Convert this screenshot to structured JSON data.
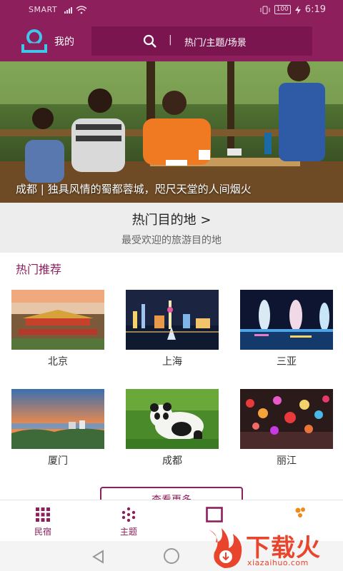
{
  "status_bar": {
    "carrier": "SMART",
    "battery": "100",
    "time": "6:19"
  },
  "header": {
    "my_label": "我的",
    "search_text": "热门/主题/场景",
    "separator": "|"
  },
  "hero": {
    "caption": "成都 | 独具风情的蜀都蓉城，咫尺天堂的人间烟火"
  },
  "destinations": {
    "title": "热门目的地 >",
    "subtitle": "最受欢迎的旅游目的地"
  },
  "recommend": {
    "title": "热门推荐",
    "cities": [
      {
        "name": "北京",
        "theme": "forbidden-city"
      },
      {
        "name": "上海",
        "theme": "bund-night"
      },
      {
        "name": "三亚",
        "theme": "phoenix-island-night"
      },
      {
        "name": "厦门",
        "theme": "xiamen-sunset"
      },
      {
        "name": "成都",
        "theme": "panda"
      },
      {
        "name": "丽江",
        "theme": "lanterns"
      }
    ]
  },
  "more_button": {
    "label": "查看更多"
  },
  "tabs": [
    {
      "label": "民宿",
      "icon": "grid-icon"
    },
    {
      "label": "主题",
      "icon": "dots-icon"
    },
    {
      "label": "",
      "icon": "square-icon"
    },
    {
      "label": "",
      "icon": "flower-icon"
    }
  ],
  "watermark": {
    "text": "下载火",
    "url": "xiazaihuo.com"
  },
  "colors": {
    "brand": "#8c1f5c",
    "brand_dark": "#7a1550",
    "banner_bg": "#ededed",
    "watermark": "#e8452c"
  }
}
